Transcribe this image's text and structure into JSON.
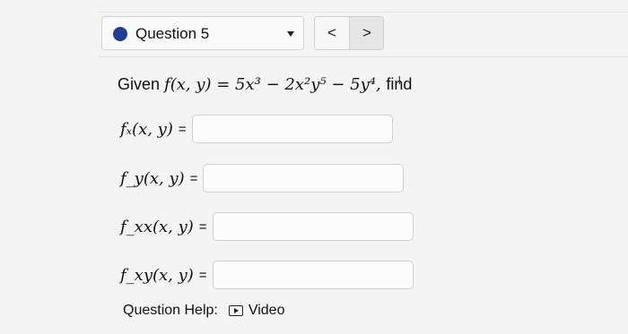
{
  "header": {
    "question_label": "Question 5",
    "prev_label": "<",
    "next_label": ">"
  },
  "problem": {
    "given_word": "Given",
    "function_text": "f(x, y) = 5x³ − 2x²y⁵ − 5y⁴,",
    "find_word": "find"
  },
  "answers": [
    {
      "lhs": "fₓ(x, y)",
      "eq": "=",
      "value": ""
    },
    {
      "lhs": "f_y(x, y)",
      "eq": "=",
      "value": ""
    },
    {
      "lhs": "f_xx(x, y)",
      "eq": "=",
      "value": ""
    },
    {
      "lhs": "f_xy(x, y)",
      "eq": "=",
      "value": ""
    }
  ],
  "help": {
    "label": "Question Help:",
    "video_label": "Video"
  },
  "colors": {
    "accent_dot": "#1d3f95",
    "background": "#f4f4f4"
  }
}
